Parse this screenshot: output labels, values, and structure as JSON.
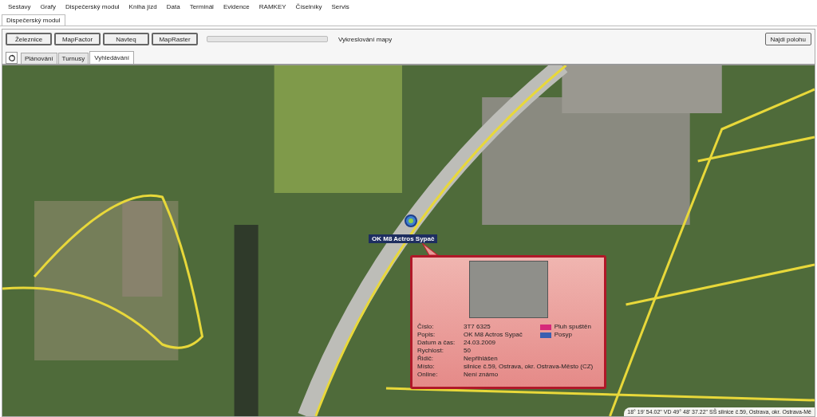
{
  "menu": [
    "Sestavy",
    "Grafy",
    "Dispečerský modul",
    "Kniha jízd",
    "Data",
    "Terminál",
    "Evidence",
    "RAMKEY",
    "Číselníky",
    "Servis"
  ],
  "document_tabs": [
    {
      "label": "Dispečerský modul",
      "selected": true
    }
  ],
  "map_buttons": [
    "Železnice",
    "MapFactor",
    "Navteq",
    "MapRaster"
  ],
  "progress": {
    "level": 0,
    "label": "Vykreslování mapy"
  },
  "find_button": "Najdi polohu",
  "tabs": [
    {
      "label": "Plánování",
      "selected": false
    },
    {
      "label": "Turnusy",
      "selected": false
    },
    {
      "label": "Vyhledávání",
      "selected": true
    }
  ],
  "vehicle_label": "OK M8 Actros Sypač",
  "popup": {
    "fields": [
      {
        "label": "Číslo:",
        "value": "3T7 6325"
      },
      {
        "label": "Popis:",
        "value": "OK M8 Actros Sypač"
      },
      {
        "label": "Datum a čas:",
        "value": "24.03.2009"
      },
      {
        "label": "Rychlost:",
        "value": "50"
      },
      {
        "label": "Řidič:",
        "value": "Nepřihlášen"
      },
      {
        "label": "Místo:",
        "value": "silnice č.59, Ostrava, okr. Ostrava-Město (CZ)"
      },
      {
        "label": "Online:",
        "value": "Není známo"
      }
    ],
    "legend": [
      {
        "label": "Pluh spuštěn",
        "color": "#d6287a"
      },
      {
        "label": "Posyp",
        "color": "#3a5fb0"
      }
    ]
  },
  "status": "18° 19' 54.02\" VD  49° 48' 37.22\" SŠ  silnice č.59, Ostrava, okr. Ostrava-Mě"
}
